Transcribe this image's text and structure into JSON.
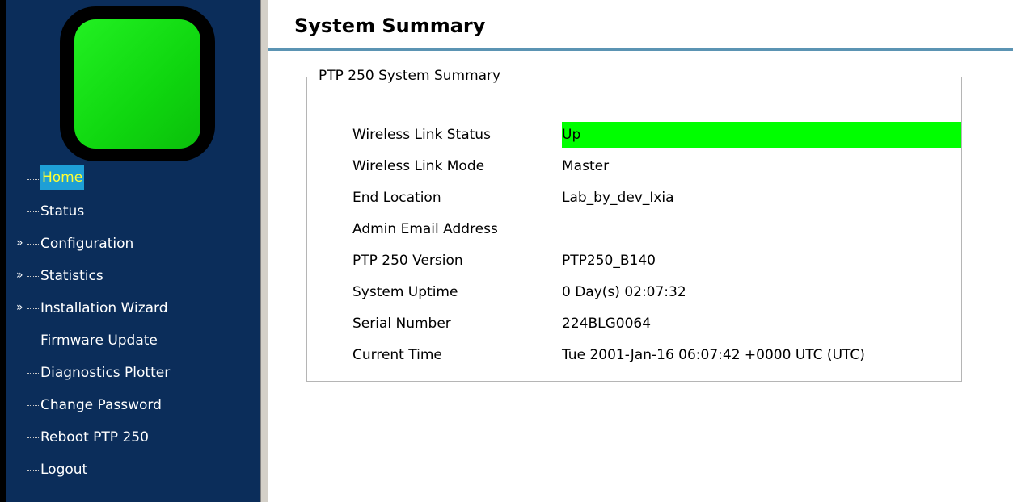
{
  "sidebar": {
    "items": [
      {
        "label": "Home",
        "active": true,
        "expandable": false
      },
      {
        "label": "Status",
        "active": false,
        "expandable": false
      },
      {
        "label": "Configuration",
        "active": false,
        "expandable": true
      },
      {
        "label": "Statistics",
        "active": false,
        "expandable": true
      },
      {
        "label": "Installation Wizard",
        "active": false,
        "expandable": true
      },
      {
        "label": "Firmware Update",
        "active": false,
        "expandable": false
      },
      {
        "label": "Diagnostics Plotter",
        "active": false,
        "expandable": false
      },
      {
        "label": "Change Password",
        "active": false,
        "expandable": false
      },
      {
        "label": "Reboot PTP 250",
        "active": false,
        "expandable": false
      },
      {
        "label": "Logout",
        "active": false,
        "expandable": false
      }
    ],
    "expander_glyph": "»",
    "colors": {
      "background": "#0b2d5a",
      "active_bg": "#1e9fd6",
      "active_text": "#ffff33",
      "logo_green": "#11dd11"
    }
  },
  "main": {
    "title": "System Summary",
    "panel": {
      "legend": "PTP 250 System Summary",
      "rows": [
        {
          "key": "Wireless Link Status",
          "value": "Up",
          "highlight": "#00ff00"
        },
        {
          "key": "Wireless Link Mode",
          "value": "Master"
        },
        {
          "key": "End Location",
          "value": "Lab_by_dev_Ixia"
        },
        {
          "key": "Admin Email Address",
          "value": ""
        },
        {
          "key": "PTP 250 Version",
          "value": "PTP250_B140"
        },
        {
          "key": "System Uptime",
          "value": "0 Day(s) 02:07:32"
        },
        {
          "key": "Serial Number",
          "value": "224BLG0064"
        },
        {
          "key": "Current Time",
          "value": "Tue 2001-Jan-16 06:07:42 +0000 UTC (UTC)"
        }
      ]
    }
  }
}
